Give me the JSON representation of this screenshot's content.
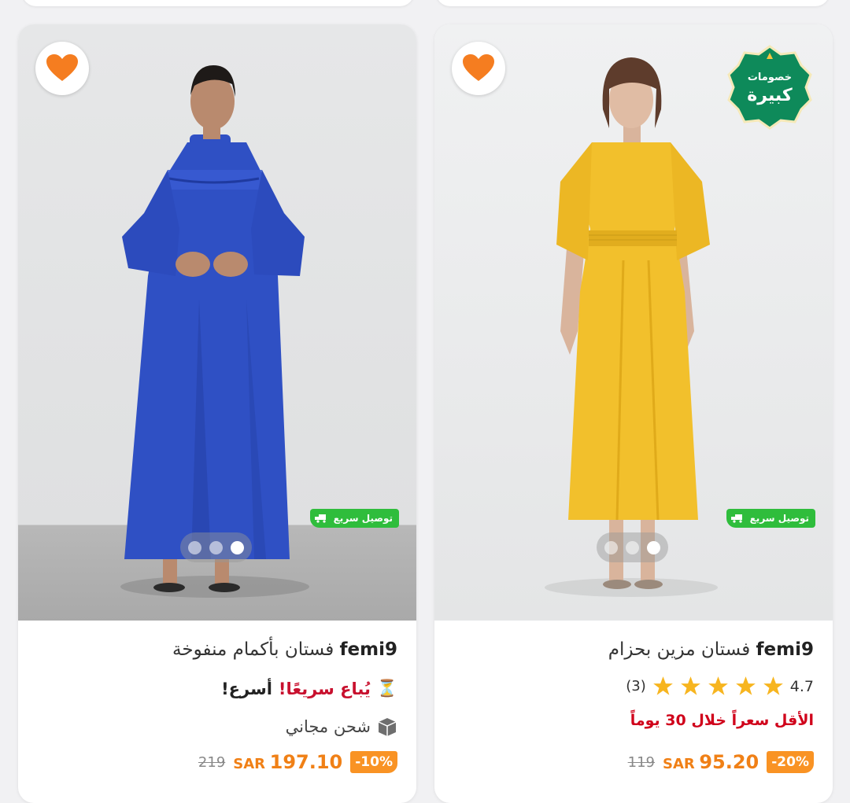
{
  "products": [
    {
      "brand": "femi9",
      "name": "فستان بأكمام منفوخة",
      "selling_fast": "يُباع سريعًا!",
      "hurry": "أسرع!",
      "shipping": "شحن مجاني",
      "fast_delivery": "توصيل سريع",
      "discount": "-10%",
      "currency": "SAR",
      "price": "197.10",
      "old_price": "219",
      "dress_color": "#2f50c4",
      "image_count": 3,
      "active_image": 3
    },
    {
      "brand": "femi9",
      "name": "فستان مزين بحزام",
      "rating": "4.7",
      "rating_count": "(3)",
      "stars": 5,
      "lowest_price": "الأقل سعراً خلال 30 يوماً",
      "fast_delivery": "توصيل سريع",
      "discount": "-20%",
      "currency": "SAR",
      "price": "95.20",
      "old_price": "119",
      "badge_line1": "خصومات",
      "badge_line2": "كبيرة",
      "dress_color": "#f2c02c",
      "image_count": 3,
      "active_image": 3
    }
  ],
  "colors": {
    "accent_orange": "#f99324",
    "heart": "#f57d20",
    "fast_delivery_green": "#2fbd3c",
    "badge_green": "#0e8a5a",
    "lowest_price_red": "#d0021b",
    "star": "#f7b51f"
  }
}
